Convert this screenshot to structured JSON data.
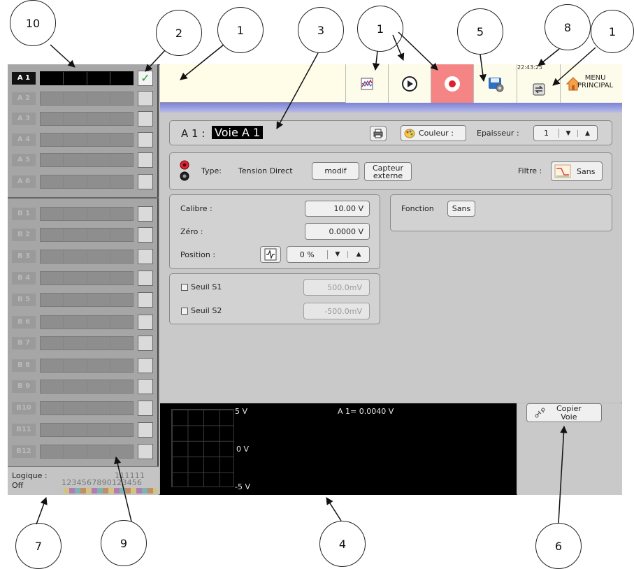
{
  "callouts": [
    "10",
    "2",
    "1",
    "3",
    "1",
    "5",
    "8",
    "1",
    "7",
    "9",
    "4",
    "6"
  ],
  "channels_a": [
    {
      "label": "A 1",
      "checked": true
    },
    {
      "label": "A 2",
      "checked": false
    },
    {
      "label": "A 3",
      "checked": false
    },
    {
      "label": "A 4",
      "checked": false
    },
    {
      "label": "A 5",
      "checked": false
    },
    {
      "label": "A 6",
      "checked": false
    }
  ],
  "channels_b": [
    {
      "label": "B 1"
    },
    {
      "label": "B 2"
    },
    {
      "label": "B 3"
    },
    {
      "label": "B 4"
    },
    {
      "label": "B 5"
    },
    {
      "label": "B 6"
    },
    {
      "label": "B 7"
    },
    {
      "label": "B 8"
    },
    {
      "label": "B 9"
    },
    {
      "label": "B10"
    },
    {
      "label": "B11"
    },
    {
      "label": "B12"
    }
  ],
  "logique": {
    "label": "Logique :",
    "state": "Off",
    "digits_top": "111111",
    "digits_bottom": "1234567890123456"
  },
  "toolbar": {
    "icons": [
      "chart-icon",
      "play-icon",
      "record-icon",
      "disk-settings-icon",
      "transfer-icon",
      "home-icon"
    ],
    "clock": "22:43:25",
    "menu_line1": "MENU",
    "menu_line2": "PRINCIPAL"
  },
  "header": {
    "channel_prefix": "A 1 :",
    "channel_name": "Voie A 1",
    "color_label": "Couleur :",
    "thickness_label": "Epaisseur :",
    "thickness_value": "1"
  },
  "type_row": {
    "type_label": "Type:",
    "type_value": "Tension Direct",
    "modify_label": "modif",
    "sensor_label_1": "Capteur",
    "sensor_label_2": "externe",
    "filter_label": "Filtre :",
    "filter_value": "Sans"
  },
  "calibration": {
    "calibre_label": "Calibre :",
    "calibre_value": "10.00 V",
    "zero_label": "Zéro :",
    "zero_value": "0.0000 V",
    "position_label": "Position :",
    "position_value": "0 %"
  },
  "function": {
    "label": "Fonction",
    "value": "Sans"
  },
  "thresholds": {
    "s1_label": "Seuil S1",
    "s1_value": "500.0mV",
    "s2_label": "Seuil S2",
    "s2_value": "-500.0mV"
  },
  "scope": {
    "top_label": "5 V",
    "mid_label": "0 V",
    "bottom_label": "-5 V",
    "readout": "A 1= 0.0040 V"
  },
  "copy_button": {
    "line1": "Copier",
    "line2": "Voie"
  },
  "colors": {
    "record_bg": "#f58484",
    "header_gradient": "#7b82d8",
    "toolbar_bg": "#fffde8",
    "check": "#2b9b2b"
  }
}
